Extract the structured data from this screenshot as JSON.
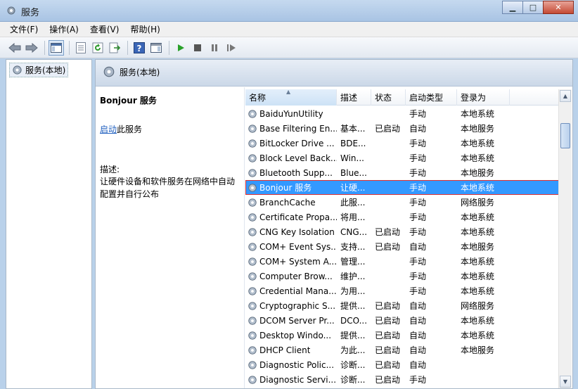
{
  "window": {
    "title": "服务"
  },
  "menu": [
    "文件(F)",
    "操作(A)",
    "查看(V)",
    "帮助(H)"
  ],
  "tree": {
    "item": "服务(本地)"
  },
  "header": {
    "title": "服务(本地)"
  },
  "detail": {
    "service_name": "Bonjour 服务",
    "start_link": "启动",
    "start_suffix": "此服务",
    "desc_label": "描述:",
    "desc_text": "让硬件设备和软件服务在网络中自动配置并自行公布"
  },
  "table": {
    "columns": [
      "名称",
      "描述",
      "状态",
      "启动类型",
      "登录为"
    ],
    "rows": [
      {
        "name": "BaiduYunUtility",
        "desc": "",
        "status": "",
        "startup": "手动",
        "logon": "本地系统"
      },
      {
        "name": "Base Filtering En...",
        "desc": "基本...",
        "status": "已启动",
        "startup": "自动",
        "logon": "本地服务"
      },
      {
        "name": "BitLocker Drive ...",
        "desc": "BDE...",
        "status": "",
        "startup": "手动",
        "logon": "本地系统"
      },
      {
        "name": "Block Level Back...",
        "desc": "Win...",
        "status": "",
        "startup": "手动",
        "logon": "本地系统"
      },
      {
        "name": "Bluetooth Supp...",
        "desc": "Blue...",
        "status": "",
        "startup": "手动",
        "logon": "本地服务"
      },
      {
        "name": "Bonjour 服务",
        "desc": "让硬...",
        "status": "",
        "startup": "手动",
        "logon": "本地系统",
        "selected": true
      },
      {
        "name": "BranchCache",
        "desc": "此服...",
        "status": "",
        "startup": "手动",
        "logon": "网络服务"
      },
      {
        "name": "Certificate Propa...",
        "desc": "将用...",
        "status": "",
        "startup": "手动",
        "logon": "本地系统"
      },
      {
        "name": "CNG Key Isolation",
        "desc": "CNG...",
        "status": "已启动",
        "startup": "手动",
        "logon": "本地系统"
      },
      {
        "name": "COM+ Event Sys...",
        "desc": "支持...",
        "status": "已启动",
        "startup": "自动",
        "logon": "本地服务"
      },
      {
        "name": "COM+ System A...",
        "desc": "管理...",
        "status": "",
        "startup": "手动",
        "logon": "本地系统"
      },
      {
        "name": "Computer Brow...",
        "desc": "维护...",
        "status": "",
        "startup": "手动",
        "logon": "本地系统"
      },
      {
        "name": "Credential Mana...",
        "desc": "为用...",
        "status": "",
        "startup": "手动",
        "logon": "本地系统"
      },
      {
        "name": "Cryptographic S...",
        "desc": "提供...",
        "status": "已启动",
        "startup": "自动",
        "logon": "网络服务"
      },
      {
        "name": "DCOM Server Pr...",
        "desc": "DCO...",
        "status": "已启动",
        "startup": "自动",
        "logon": "本地系统"
      },
      {
        "name": "Desktop Windo...",
        "desc": "提供...",
        "status": "已启动",
        "startup": "自动",
        "logon": "本地系统"
      },
      {
        "name": "DHCP Client",
        "desc": "为此...",
        "status": "已启动",
        "startup": "自动",
        "logon": "本地服务"
      },
      {
        "name": "Diagnostic Polic...",
        "desc": "诊断...",
        "status": "已启动",
        "startup": "自动",
        "logon": ""
      },
      {
        "name": "Diagnostic Servi...",
        "desc": "诊断...",
        "status": "已启动",
        "startup": "手动",
        "logon": ""
      }
    ]
  },
  "colors": {
    "selection": "#3399ff",
    "highlight_border": "#e03030",
    "link": "#1f5fbf"
  }
}
